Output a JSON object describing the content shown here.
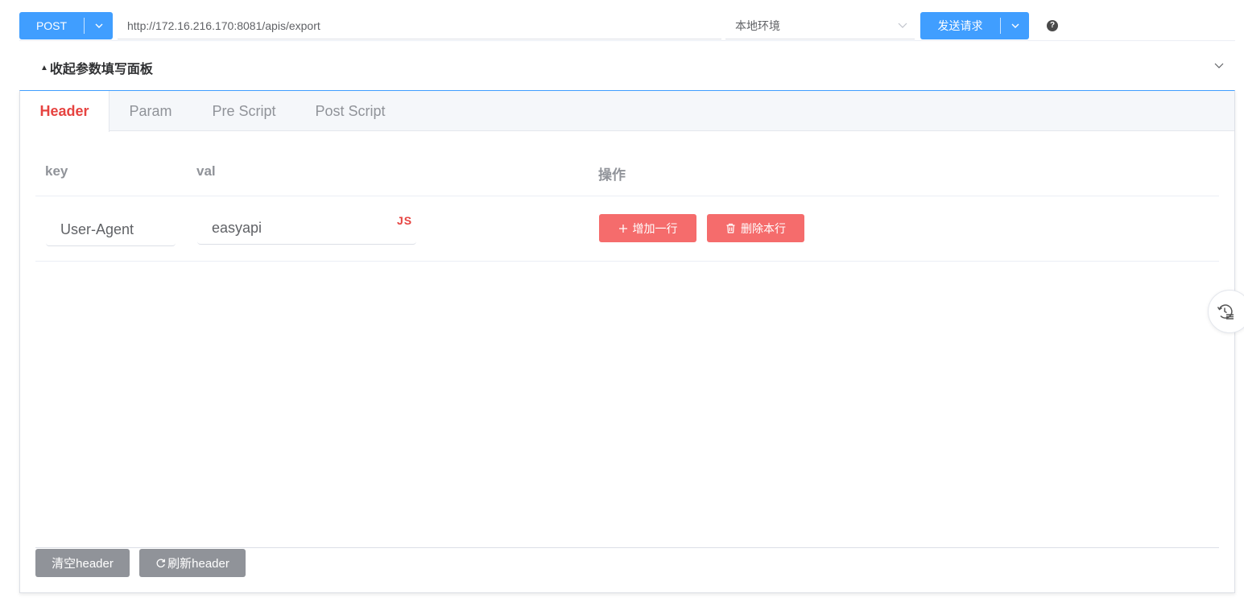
{
  "request_bar": {
    "method": "POST",
    "url": "http://172.16.216.170:8081/apis/export",
    "environment": "本地环境",
    "send_label": "发送请求",
    "help_glyph": "?"
  },
  "collapse": {
    "title": "收起参数填写面板",
    "collapsed_indicator": "▲"
  },
  "tabs": [
    {
      "label": "Header",
      "active": true
    },
    {
      "label": "Param",
      "active": false
    },
    {
      "label": "Pre Script",
      "active": false
    },
    {
      "label": "Post Script",
      "active": false
    }
  ],
  "table": {
    "columns": [
      "key",
      "val",
      "操作"
    ],
    "rows": [
      {
        "key": "User-Agent",
        "val": "easyapi",
        "val_badge": "JS"
      }
    ],
    "add_row_label": "增加一行",
    "delete_row_label": "删除本行"
  },
  "footer": {
    "clear_label": "清空header",
    "refresh_label": "刷新header"
  },
  "colors": {
    "primary": "#409eff",
    "danger": "#f56c6c",
    "active_tab": "#e64340",
    "neutral_button": "#909399"
  },
  "icons": {
    "method_dropdown": "chevron-down-icon",
    "env_dropdown": "chevron-down-icon",
    "send_dropdown": "chevron-down-icon",
    "help": "question-circle-icon",
    "collapse_toggle": "chevron-down-icon",
    "add_row": "plus-icon",
    "delete_row": "trash-icon",
    "refresh": "refresh-icon",
    "history": "history-icon"
  }
}
